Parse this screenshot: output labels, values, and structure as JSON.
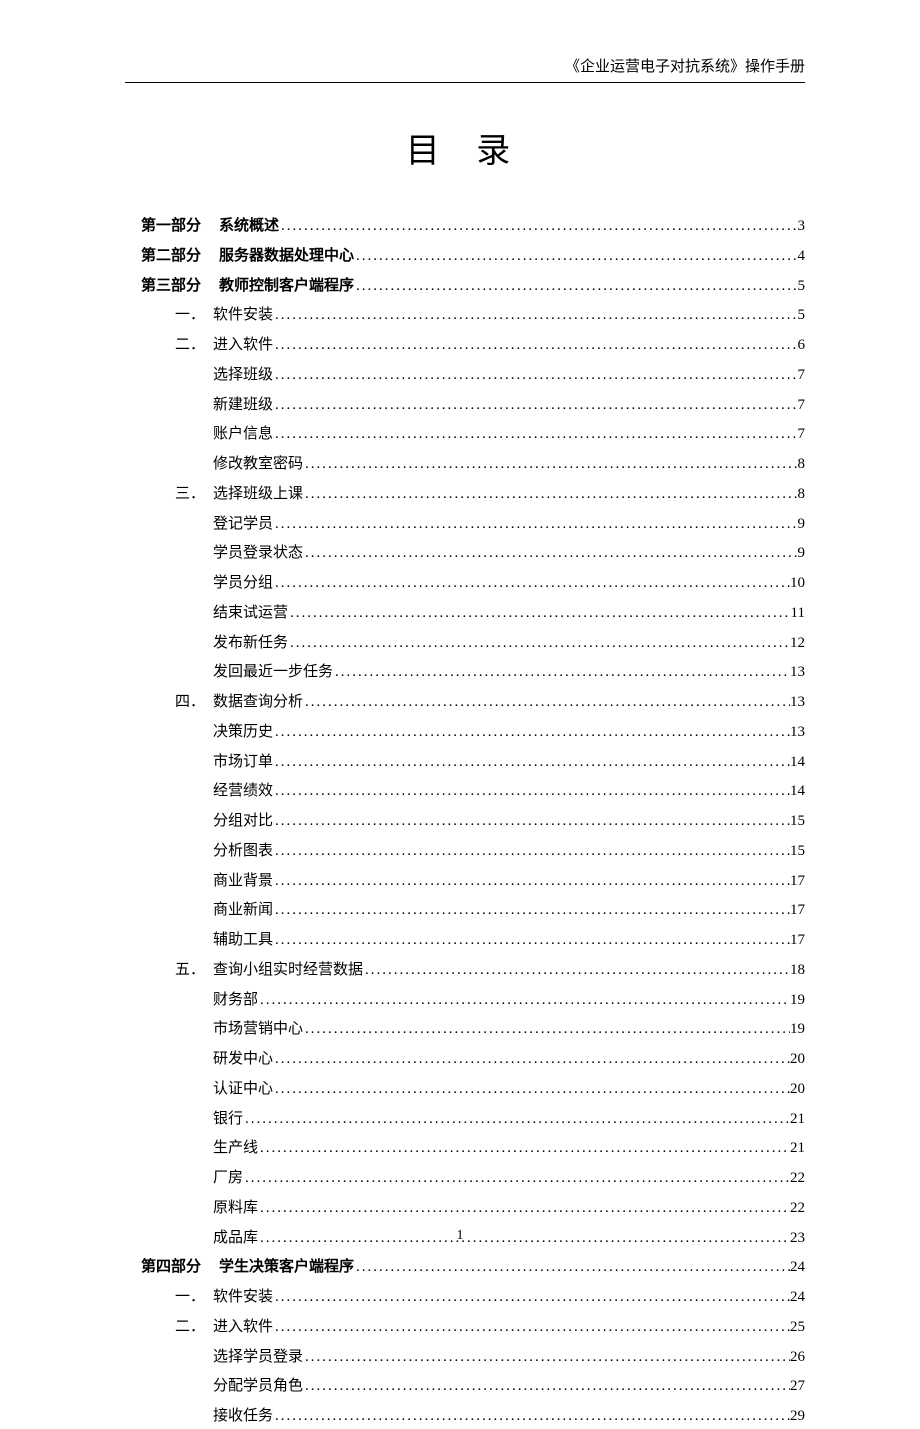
{
  "header_text": "《企业运营电子对抗系统》操作手册",
  "title": "目 录",
  "page_number": "1",
  "toc": [
    {
      "level": 0,
      "prefix": "第一部分",
      "label": "系统概述",
      "page": "3"
    },
    {
      "level": 0,
      "prefix": "第二部分",
      "label": "服务器数据处理中心",
      "page": "4"
    },
    {
      "level": 0,
      "prefix": "第三部分",
      "label": "教师控制客户端程序",
      "page": "5"
    },
    {
      "level": 1,
      "prefix": "一．",
      "label": "软件安装",
      "page": "5"
    },
    {
      "level": 1,
      "prefix": "二．",
      "label": "进入软件",
      "page": "6"
    },
    {
      "level": 2,
      "prefix": "",
      "label": "选择班级",
      "page": "7"
    },
    {
      "level": 2,
      "prefix": "",
      "label": "新建班级",
      "page": "7"
    },
    {
      "level": 2,
      "prefix": "",
      "label": "账户信息",
      "page": "7"
    },
    {
      "level": 2,
      "prefix": "",
      "label": "修改教室密码",
      "page": "8"
    },
    {
      "level": 1,
      "prefix": "三．",
      "label": "选择班级上课",
      "page": "8"
    },
    {
      "level": 2,
      "prefix": "",
      "label": "登记学员",
      "page": "9"
    },
    {
      "level": 2,
      "prefix": "",
      "label": "学员登录状态",
      "page": "9"
    },
    {
      "level": 2,
      "prefix": "",
      "label": "学员分组",
      "page": "10"
    },
    {
      "level": 2,
      "prefix": "",
      "label": "结束试运营",
      "page": "11"
    },
    {
      "level": 2,
      "prefix": "",
      "label": "发布新任务",
      "page": "12"
    },
    {
      "level": 2,
      "prefix": "",
      "label": "发回最近一步任务",
      "page": "13"
    },
    {
      "level": 1,
      "prefix": "四．",
      "label": "数据查询分析",
      "page": "13"
    },
    {
      "level": 2,
      "prefix": "",
      "label": "决策历史",
      "page": "13"
    },
    {
      "level": 2,
      "prefix": "",
      "label": "市场订单",
      "page": "14"
    },
    {
      "level": 2,
      "prefix": "",
      "label": "经营绩效",
      "page": "14"
    },
    {
      "level": 2,
      "prefix": "",
      "label": "分组对比",
      "page": "15"
    },
    {
      "level": 2,
      "prefix": "",
      "label": "分析图表",
      "page": "15"
    },
    {
      "level": 2,
      "prefix": "",
      "label": "商业背景",
      "page": "17"
    },
    {
      "level": 2,
      "prefix": "",
      "label": "商业新闻",
      "page": "17"
    },
    {
      "level": 2,
      "prefix": "",
      "label": "辅助工具",
      "page": "17"
    },
    {
      "level": 1,
      "prefix": "五．",
      "label": "查询小组实时经营数据",
      "page": "18"
    },
    {
      "level": 2,
      "prefix": "",
      "label": "财务部",
      "page": "19"
    },
    {
      "level": 2,
      "prefix": "",
      "label": "市场营销中心",
      "page": "19"
    },
    {
      "level": 2,
      "prefix": "",
      "label": "研发中心",
      "page": "20"
    },
    {
      "level": 2,
      "prefix": "",
      "label": "认证中心",
      "page": "20"
    },
    {
      "level": 2,
      "prefix": "",
      "label": "银行",
      "page": "21"
    },
    {
      "level": 2,
      "prefix": "",
      "label": "生产线",
      "page": "21"
    },
    {
      "level": 2,
      "prefix": "",
      "label": "厂房",
      "page": "22"
    },
    {
      "level": 2,
      "prefix": "",
      "label": "原料库",
      "page": "22"
    },
    {
      "level": 2,
      "prefix": "",
      "label": "成品库",
      "page": "23"
    },
    {
      "level": 0,
      "prefix": "第四部分",
      "label": "学生决策客户端程序",
      "page": "24"
    },
    {
      "level": 1,
      "prefix": "一．",
      "label": "软件安装",
      "page": "24"
    },
    {
      "level": 1,
      "prefix": "二．",
      "label": "进入软件",
      "page": "25"
    },
    {
      "level": 2,
      "prefix": "",
      "label": "选择学员登录",
      "page": "26"
    },
    {
      "level": 2,
      "prefix": "",
      "label": "分配学员角色",
      "page": "27"
    },
    {
      "level": 2,
      "prefix": "",
      "label": "接收任务",
      "page": "29"
    }
  ]
}
